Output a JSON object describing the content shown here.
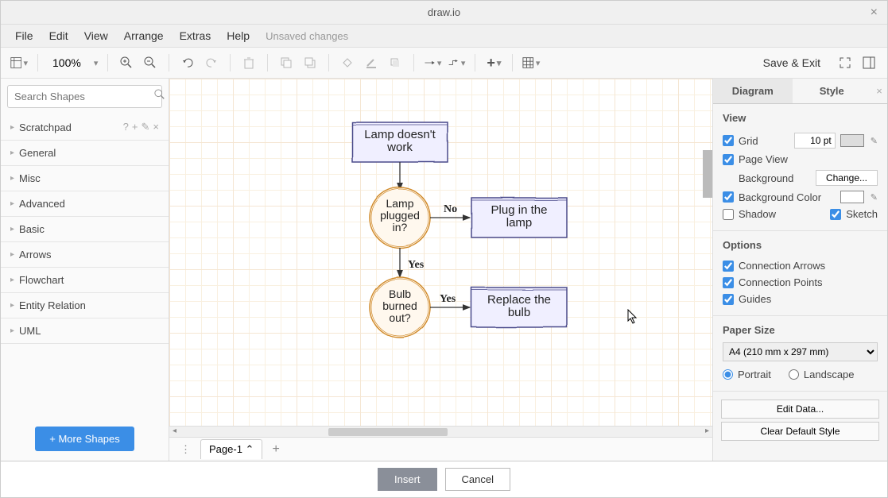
{
  "app_title": "draw.io",
  "menubar": {
    "file": "File",
    "edit": "Edit",
    "view": "View",
    "arrange": "Arrange",
    "extras": "Extras",
    "help": "Help",
    "unsaved": "Unsaved changes"
  },
  "toolbar": {
    "zoom": "100%",
    "save_exit": "Save & Exit"
  },
  "search": {
    "placeholder": "Search Shapes"
  },
  "shape_groups": {
    "scratchpad": "Scratchpad",
    "general": "General",
    "misc": "Misc",
    "advanced": "Advanced",
    "basic": "Basic",
    "arrows": "Arrows",
    "flowchart": "Flowchart",
    "entity": "Entity Relation",
    "uml": "UML"
  },
  "more_shapes": "+  More Shapes",
  "tabs": {
    "page1": "Page-1"
  },
  "rightpanel": {
    "tab_diagram": "Diagram",
    "tab_style": "Style",
    "view_hdr": "View",
    "grid": "Grid",
    "grid_value": "10 pt",
    "pageview": "Page View",
    "background": "Background",
    "change": "Change...",
    "bgcolor": "Background Color",
    "shadow": "Shadow",
    "sketch": "Sketch",
    "options_hdr": "Options",
    "conn_arrows": "Connection Arrows",
    "conn_points": "Connection Points",
    "guides": "Guides",
    "papersize_hdr": "Paper Size",
    "paper_option": "A4 (210 mm x 297 mm)",
    "portrait": "Portrait",
    "landscape": "Landscape",
    "edit_data": "Edit Data...",
    "clear_default": "Clear Default Style"
  },
  "footer": {
    "insert": "Insert",
    "cancel": "Cancel"
  },
  "diagram": {
    "node_lamp_broken": "Lamp doesn't\nwork",
    "node_plugged": "Lamp\nplugged\nin?",
    "node_plugin": "Plug in the\nlamp",
    "node_bulb": "Bulb\nburned\nout?",
    "node_replace": "Replace the\nbulb",
    "label_no": "No",
    "label_yes1": "Yes",
    "label_yes2": "Yes"
  }
}
